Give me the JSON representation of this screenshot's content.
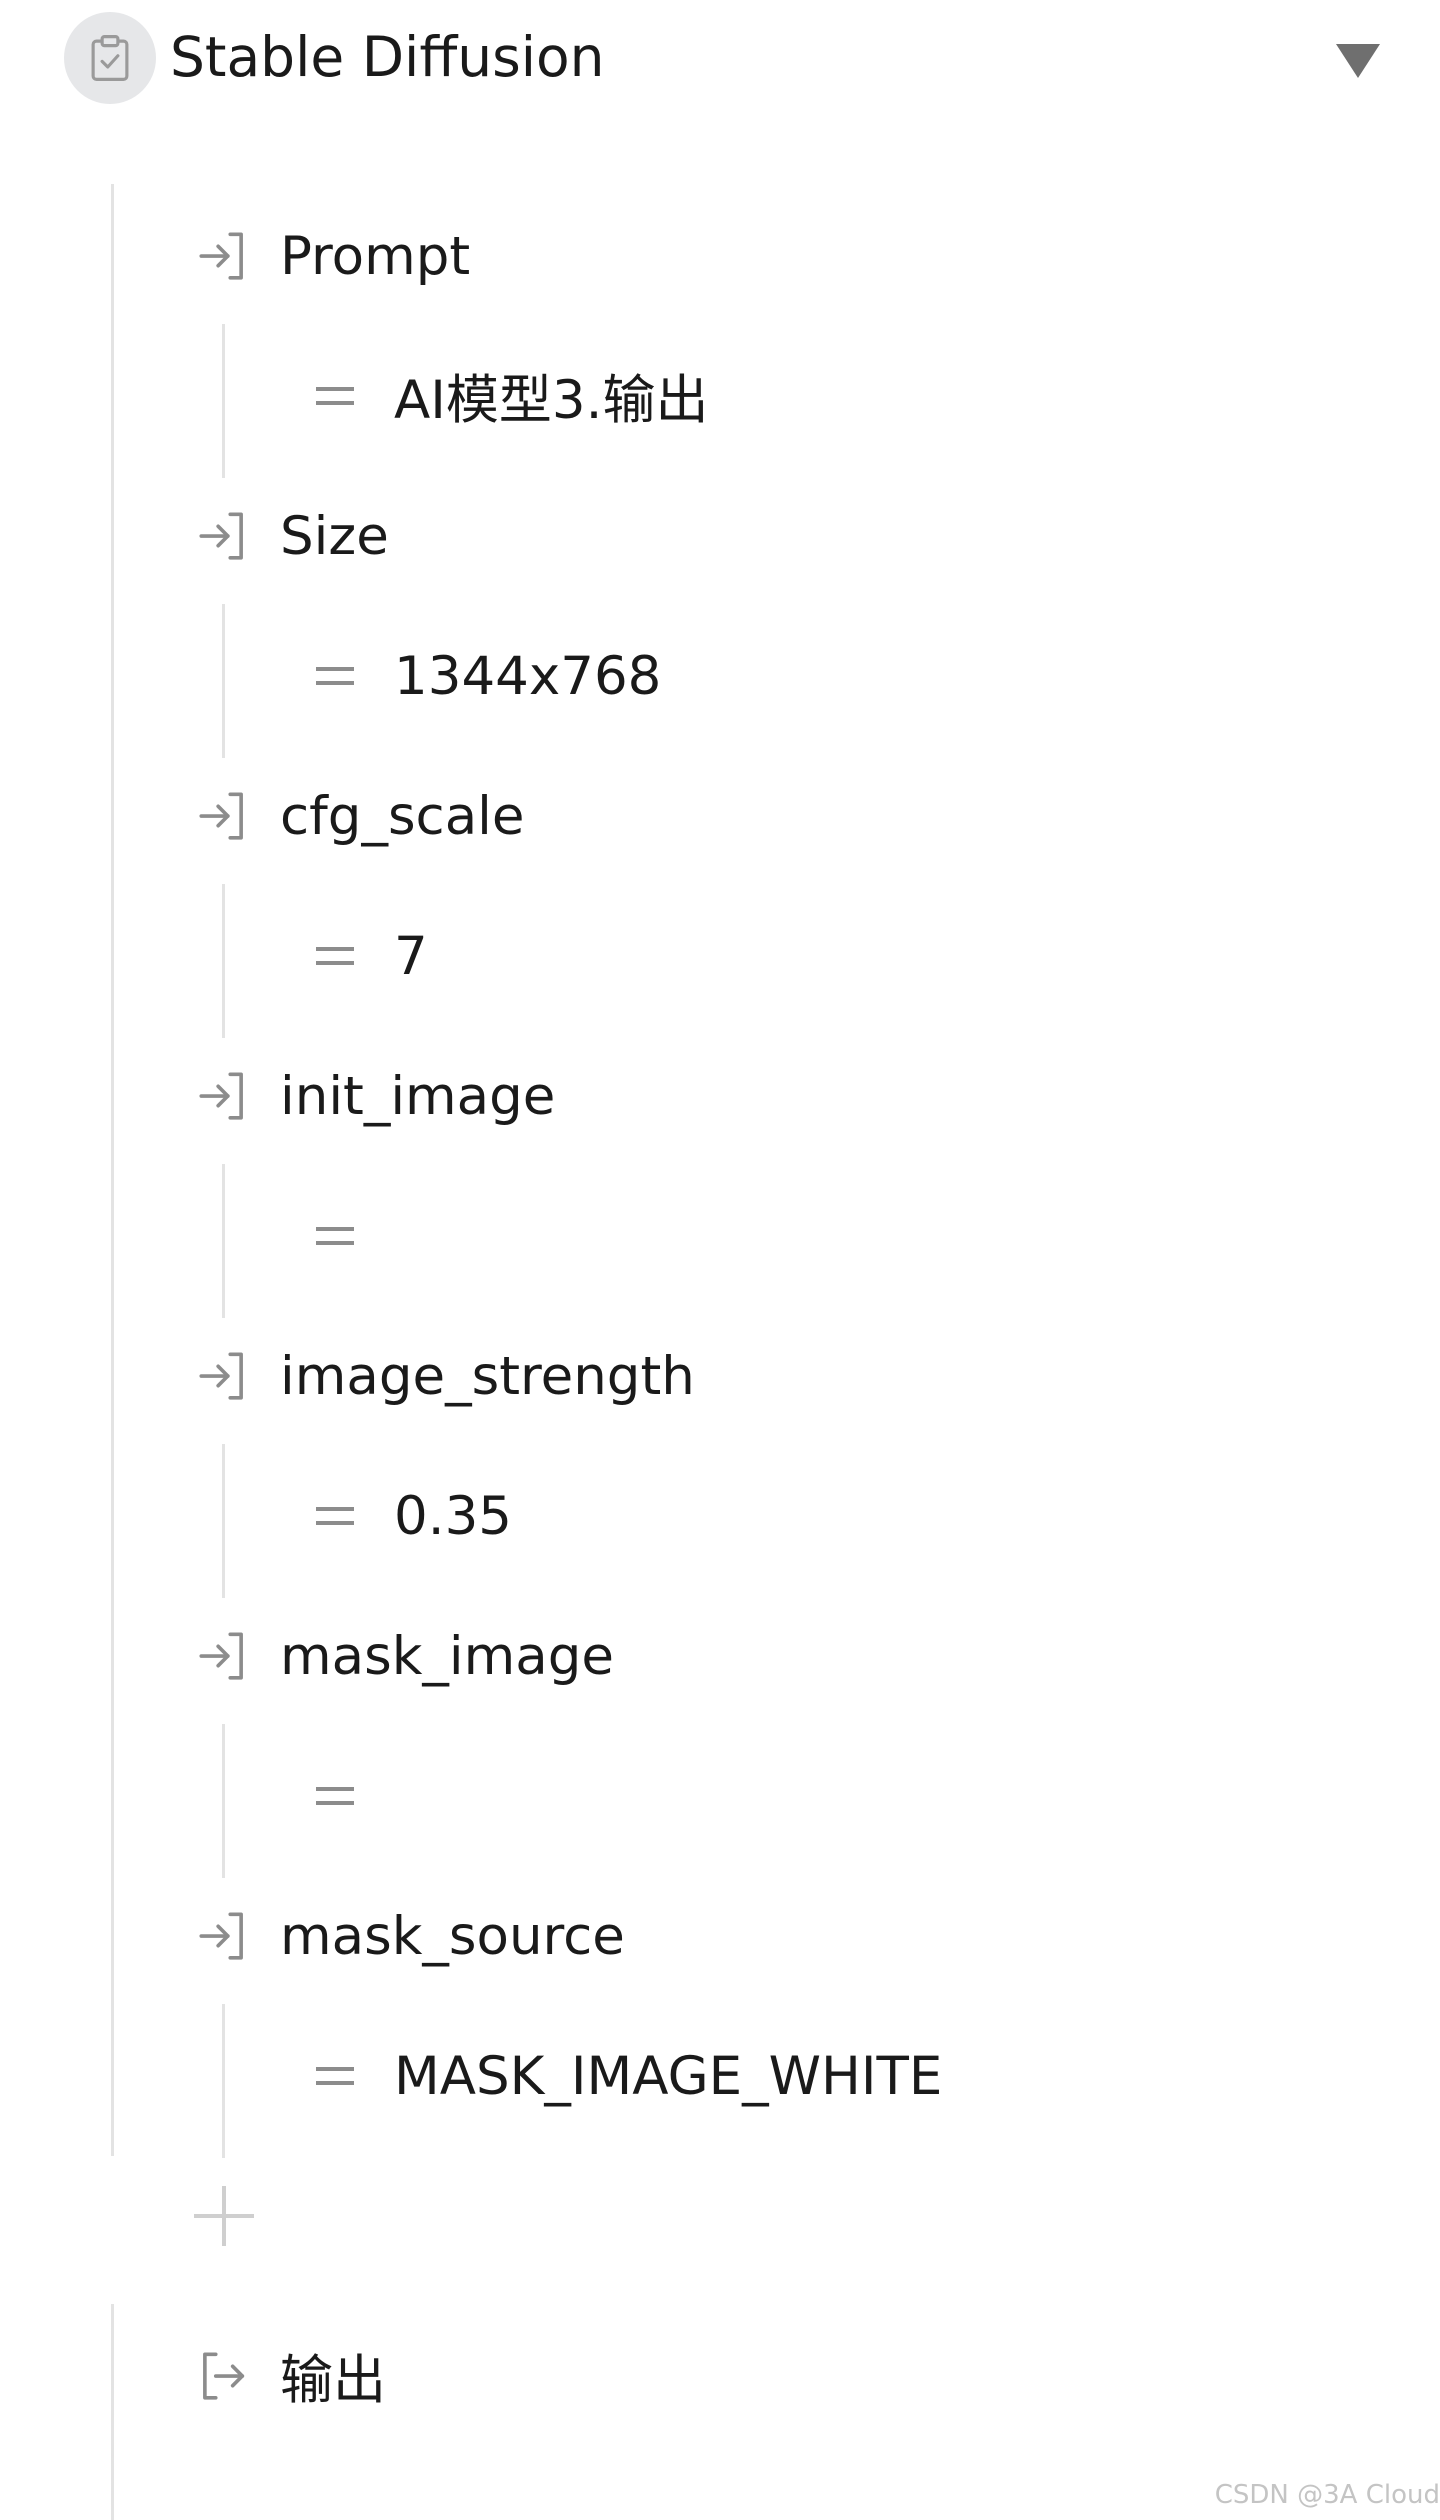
{
  "node": {
    "title": "Stable Diffusion",
    "icon": "clipboard-check-icon",
    "toggle_icon": "triangle-down-icon"
  },
  "params": [
    {
      "name": "Prompt",
      "value": "AI模型3.输出"
    },
    {
      "name": "Size",
      "value": "1344x768"
    },
    {
      "name": "cfg_scale",
      "value": "7"
    },
    {
      "name": "init_image",
      "value": ""
    },
    {
      "name": "image_strength",
      "value": "0.35"
    },
    {
      "name": "mask_image",
      "value": ""
    },
    {
      "name": "mask_source",
      "value": "MASK_IMAGE_WHITE"
    }
  ],
  "add_button_icon": "plus-icon",
  "output": {
    "label": "输出",
    "icon": "output-arrow-icon"
  },
  "watermark": "CSDN @3A Cloud",
  "colors": {
    "icon_gray": "#8c8c8c",
    "line_gray": "#e3e3e3",
    "circle_bg": "#e6e7e9",
    "text": "#1a1a1a"
  }
}
